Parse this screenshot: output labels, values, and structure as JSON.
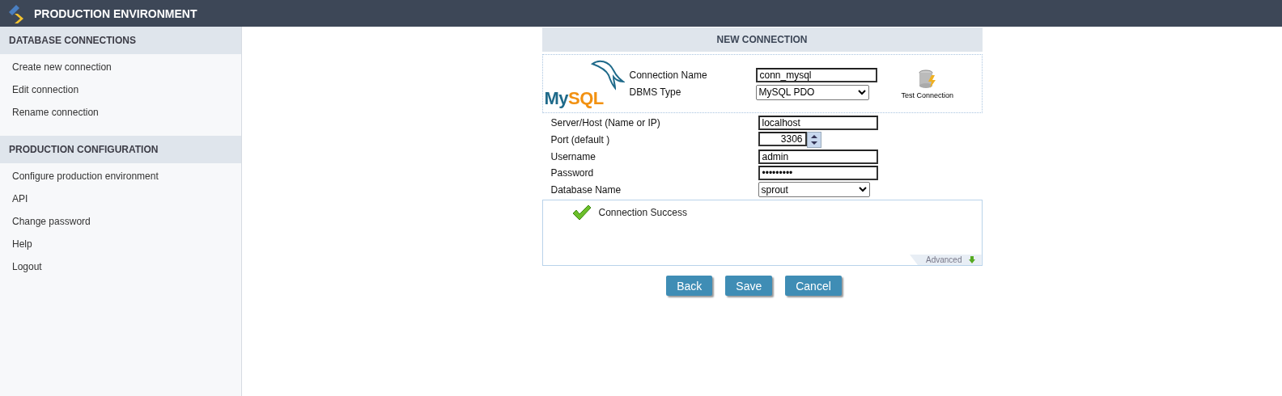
{
  "header": {
    "title": "PRODUCTION ENVIRONMENT"
  },
  "sidebar": {
    "sections": [
      {
        "title": "DATABASE CONNECTIONS",
        "items": [
          "Create new connection",
          "Edit connection",
          "Rename connection"
        ]
      },
      {
        "title": "PRODUCTION CONFIGURATION",
        "items": [
          "Configure production environment",
          "API",
          "Change password",
          "Help",
          "Logout"
        ]
      }
    ]
  },
  "panel": {
    "title": "NEW CONNECTION",
    "logo": {
      "text_a": "My",
      "text_b": "SQL"
    },
    "top_fields": [
      {
        "kind": "text",
        "label": "Connection Name",
        "value": "conn_mysql"
      },
      {
        "kind": "select",
        "label": "DBMS Type",
        "value": "MySQL PDO"
      }
    ],
    "test_button": "Test Connection",
    "fields": [
      {
        "kind": "text",
        "label": "Server/Host (Name or IP)",
        "value": "localhost"
      },
      {
        "kind": "number",
        "label": "Port (default )",
        "value": "3306"
      },
      {
        "kind": "text",
        "label": "Username",
        "value": "admin"
      },
      {
        "kind": "text",
        "label": "Password",
        "value": "•••••••••"
      },
      {
        "kind": "select",
        "label": "Database Name",
        "value": "sprout"
      }
    ],
    "message": "Connection Success",
    "advanced": "Advanced",
    "buttons": [
      "Back",
      "Save",
      "Cancel"
    ]
  }
}
